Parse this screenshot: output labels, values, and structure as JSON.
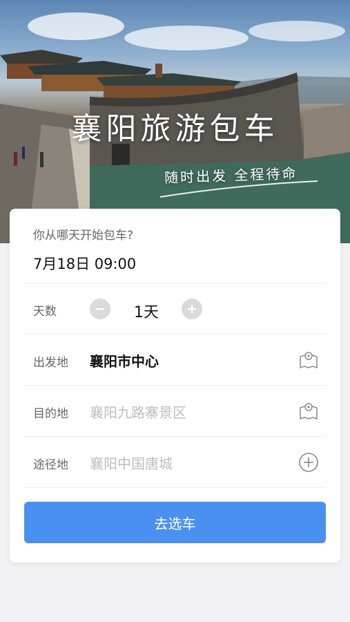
{
  "hero": {
    "title": "襄阳旅游包车",
    "subtitle": "随时出发 全程待命"
  },
  "form": {
    "question": "你从哪天开始包车?",
    "date_value": "7月18日 09:00",
    "days": {
      "label": "天数",
      "value": "1天"
    },
    "departure": {
      "label": "出发地",
      "value": "襄阳市中心"
    },
    "destination": {
      "label": "目的地",
      "placeholder": "襄阳九路寨景区"
    },
    "via": {
      "label": "途径地",
      "placeholder": "襄阳中国唐城"
    },
    "submit_label": "去选车"
  },
  "colors": {
    "accent": "#4a90f0",
    "background": "#f2f2f5"
  }
}
